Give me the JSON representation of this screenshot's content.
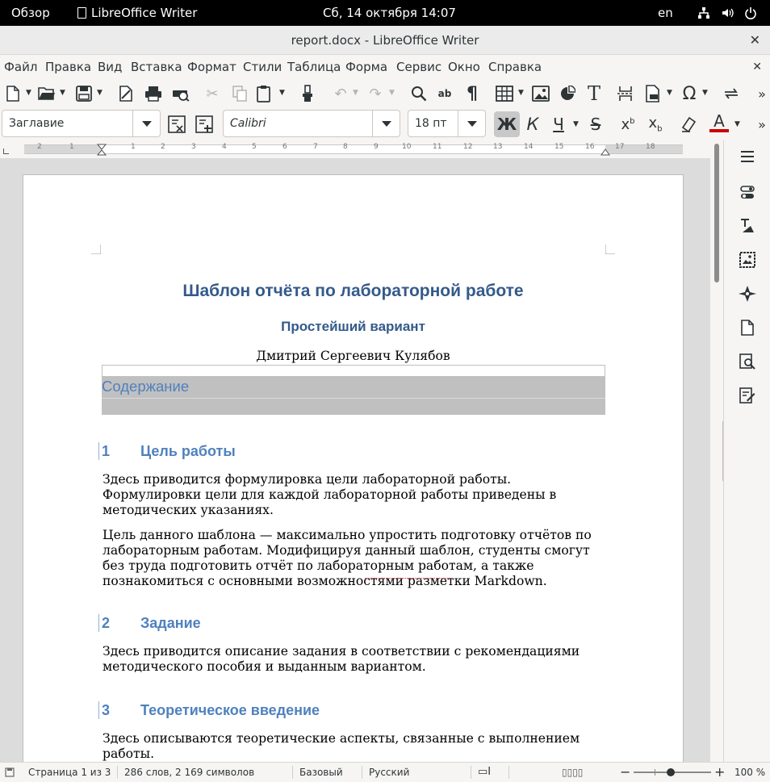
{
  "gnome": {
    "activities": "Обзор",
    "app_menu": "LibreOffice Writer",
    "clock": "Сб, 14 октября  14:07",
    "keyboard_layout": "en"
  },
  "window": {
    "title": "report.docx - LibreOffice Writer"
  },
  "menu": {
    "items": [
      "Файл",
      "Правка",
      "Вид",
      "Вставка",
      "Формат",
      "Стили",
      "Таблица",
      "Форма",
      "Сервис",
      "Окно",
      "Справка"
    ]
  },
  "formatting": {
    "paragraph_style": "Заглавие",
    "font_name": "Calibri",
    "font_size": "18 пт",
    "bold_active": true,
    "font_color": "#cc0000"
  },
  "ruler": {
    "ticks": [
      "2",
      "1",
      "1",
      "2",
      "3",
      "4",
      "5",
      "6",
      "7",
      "8",
      "9",
      "10",
      "11",
      "12",
      "13",
      "14",
      "15",
      "16",
      "17",
      "18"
    ]
  },
  "document": {
    "title": "Шаблон отчёта по лабораторной работе",
    "subtitle": "Простейший вариант",
    "author": "Дмитрий Сергеевич Кулябов",
    "toc_heading": "Содержание",
    "sections": [
      {
        "number": "1",
        "heading": "Цель работы",
        "paragraphs": [
          "Здесь приводится формулировка цели лабораторной работы. Формулировки цели для каждой лабораторной работы приведены в методических указаниях.",
          "Цель данного шаблона — максимально упростить подготовку отчётов по лабораторным работам. Модифицируя данный шаблон, студенты смогут без труда подготовить отчёт по лабораторным работам, а также познакомиться с основными возможностями разметки Markdown."
        ]
      },
      {
        "number": "2",
        "heading": "Задание",
        "paragraphs": [
          "Здесь приводится описание задания в соответствии с рекомендациями методического пособия и выданным вариантом."
        ]
      },
      {
        "number": "3",
        "heading": "Теоретическое введение",
        "paragraphs": [
          "Здесь описываются теоретические аспекты, связанные с выполнением работы."
        ]
      }
    ]
  },
  "status": {
    "page": "Страница 1 из 3",
    "words": "286 слов, 2 169 символов",
    "page_style": "Базовый",
    "language": "Русский",
    "zoom": "100 %"
  },
  "colors": {
    "title": "#345a8a",
    "heading": "#4f81bd",
    "toc_bg": "#c0c0c0"
  }
}
